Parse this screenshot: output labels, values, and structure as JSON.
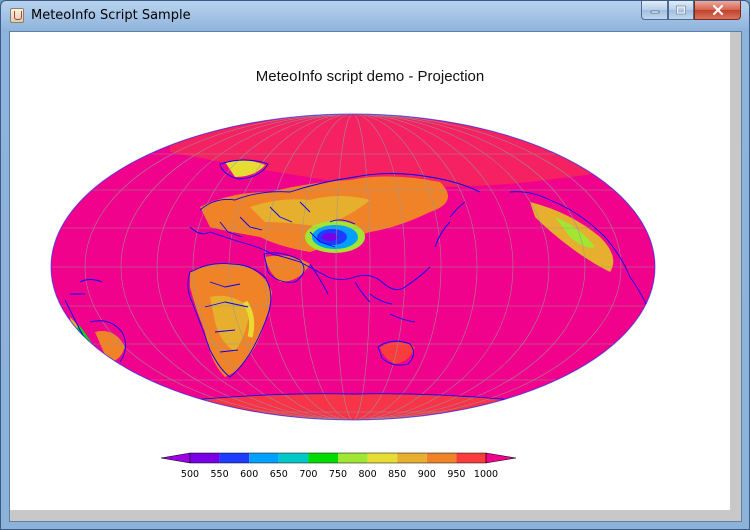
{
  "window": {
    "title": "MeteoInfo Script Sample",
    "icon": "java-cup-icon",
    "controls": {
      "minimize": "minimize-icon",
      "maximize": "maximize-icon",
      "close": "close-icon"
    }
  },
  "figure": {
    "title": "MeteoInfo script demo - Projection",
    "map_projection": "Hammer-Aitoff (elliptical world)",
    "coastline_color": "#0000ff",
    "graticule_color": "#999999"
  },
  "chart_data": {
    "type": "heatmap",
    "title": "MeteoInfo script demo - Projection",
    "colorbar": {
      "levels": [
        500,
        550,
        600,
        650,
        700,
        750,
        800,
        850,
        900,
        950,
        1000
      ],
      "level_labels": [
        "500",
        "550",
        "600",
        "650",
        "700",
        "750",
        "800",
        "850",
        "900",
        "950",
        "1000"
      ],
      "colors": [
        "#9b00e0",
        "#7800e6",
        "#1e3cff",
        "#00a0ff",
        "#00c8c8",
        "#00dc00",
        "#a0e632",
        "#e6dc32",
        "#e6af2d",
        "#f08228",
        "#fa3c3c",
        "#f0028c"
      ],
      "extend": "both",
      "orientation": "horizontal",
      "position": "bottom"
    },
    "dominant_color": "#f0028c"
  }
}
